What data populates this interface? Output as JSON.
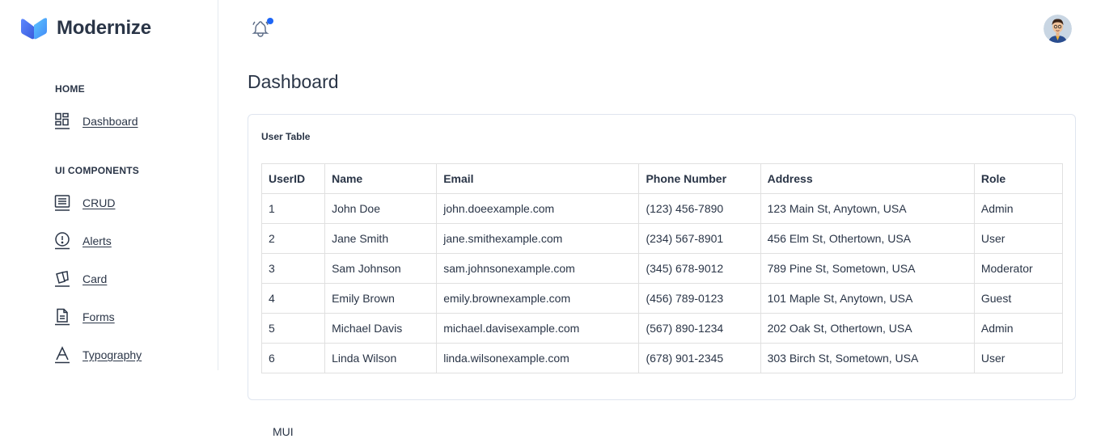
{
  "brand": {
    "name": "Modernize"
  },
  "sidebar": {
    "sections": [
      {
        "caption": "HOME",
        "items": [
          {
            "label": "Dashboard",
            "icon": "dashboard-icon"
          }
        ]
      },
      {
        "caption": "UI COMPONENTS",
        "items": [
          {
            "label": "CRUD",
            "icon": "list-details-icon"
          },
          {
            "label": "Alerts",
            "icon": "alert-circle-icon"
          },
          {
            "label": "Card",
            "icon": "cards-icon"
          },
          {
            "label": "Forms",
            "icon": "file-description-icon"
          },
          {
            "label": "Typography",
            "icon": "typography-icon"
          }
        ]
      }
    ]
  },
  "header": {
    "notification_icon": "bell-ringing-icon",
    "has_unread": true,
    "avatar_icon": "user-avatar"
  },
  "page": {
    "title": "Dashboard"
  },
  "user_table": {
    "title": "User Table",
    "columns": [
      "UserID",
      "Name",
      "Email",
      "Phone Number",
      "Address",
      "Role"
    ],
    "rows": [
      [
        "1",
        "John Doe",
        "john.doeexample.com",
        "(123) 456-7890",
        "123 Main St, Anytown, USA",
        "Admin"
      ],
      [
        "2",
        "Jane Smith",
        "jane.smithexample.com",
        "(234) 567-8901",
        "456 Elm St, Othertown, USA",
        "User"
      ],
      [
        "3",
        "Sam Johnson",
        "sam.johnsonexample.com",
        "(345) 678-9012",
        "789 Pine St, Sometown, USA",
        "Moderator"
      ],
      [
        "4",
        "Emily Brown",
        "emily.brownexample.com",
        "(456) 789-0123",
        "101 Maple St, Anytown, USA",
        "Guest"
      ],
      [
        "5",
        "Michael Davis",
        "michael.davisexample.com",
        "(567) 890-1234",
        "202 Oak St, Othertown, USA",
        "Admin"
      ],
      [
        "6",
        "Linda Wilson",
        "linda.wilsonexample.com",
        "(678) 901-2345",
        "303 Birch St, Sometown, USA",
        "User"
      ]
    ]
  },
  "footer": {
    "text": "MUI"
  },
  "colors": {
    "primary": "#1e66f5",
    "text": "#2a3547",
    "border": "#dfe5ef"
  }
}
